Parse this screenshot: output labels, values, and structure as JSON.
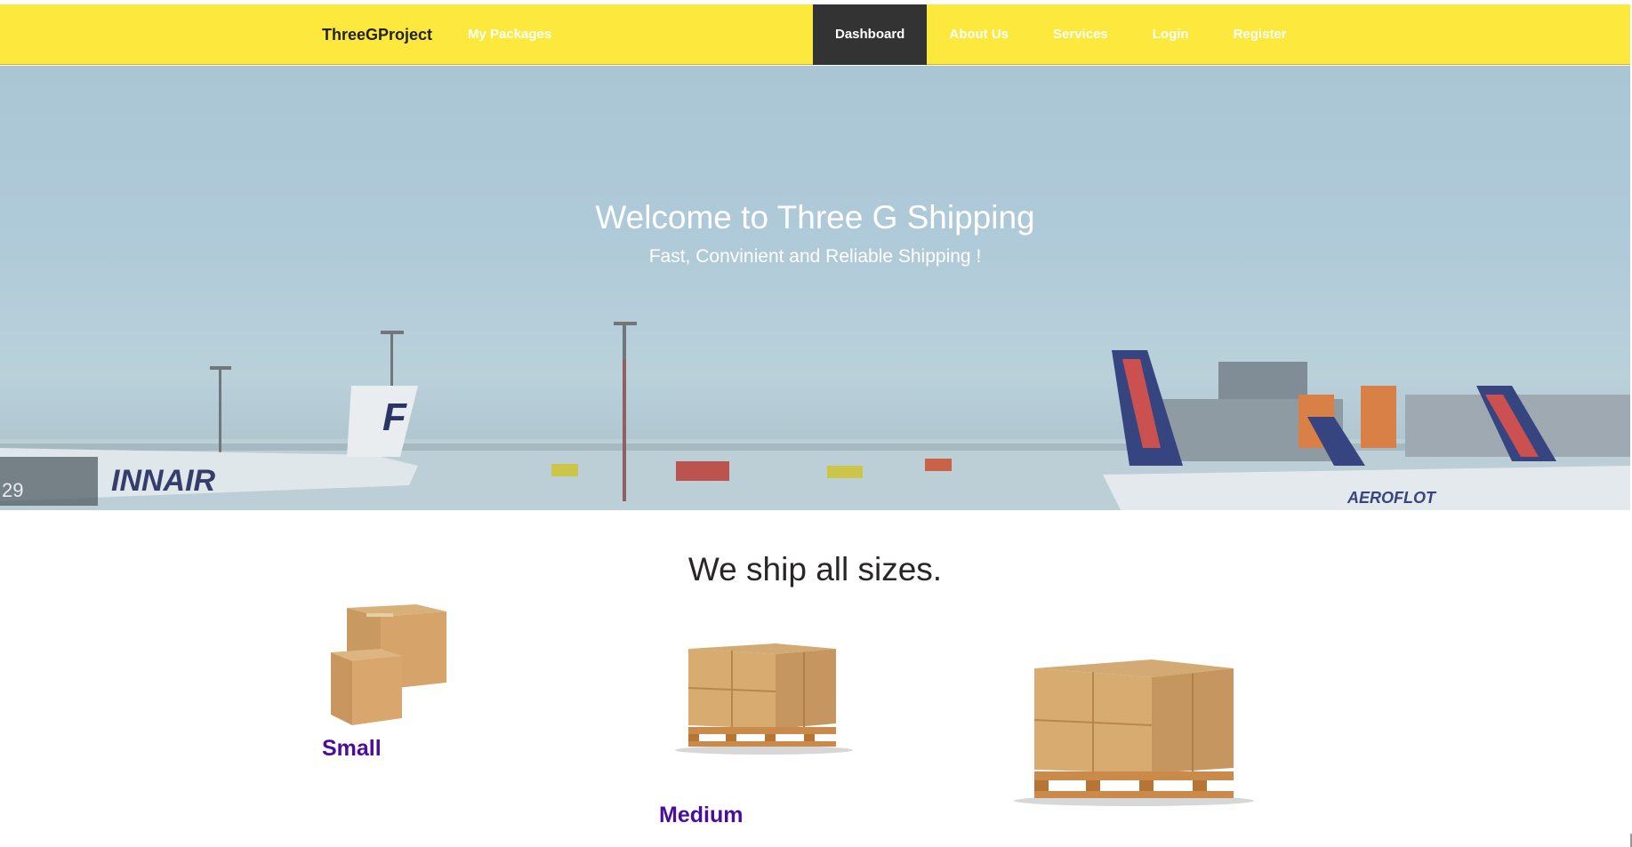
{
  "navbar": {
    "brand": "ThreeGProject",
    "left_link": "My Packages",
    "right_items": [
      {
        "label": "Dashboard",
        "active": true
      },
      {
        "label": "About Us",
        "active": false
      },
      {
        "label": "Services",
        "active": false
      },
      {
        "label": "Login",
        "active": false
      },
      {
        "label": "Register",
        "active": false
      }
    ]
  },
  "hero": {
    "title": "Welcome to Three G Shipping",
    "subtitle": "Fast, Convinient and Reliable Shipping !",
    "background_texts": [
      "INNAIR",
      "AEROFLOT",
      "29"
    ]
  },
  "sizes": {
    "heading": "We ship all sizes.",
    "items": [
      {
        "label": "Small",
        "icon": "stacked-boxes-icon"
      },
      {
        "label": "Medium",
        "icon": "pallet-boxes-icon"
      },
      {
        "label": "",
        "icon": "large-pallet-boxes-icon"
      }
    ]
  },
  "colors": {
    "navbar": "#fde93d",
    "nav_active": "#333333",
    "size_label": "#4a0e9a"
  }
}
